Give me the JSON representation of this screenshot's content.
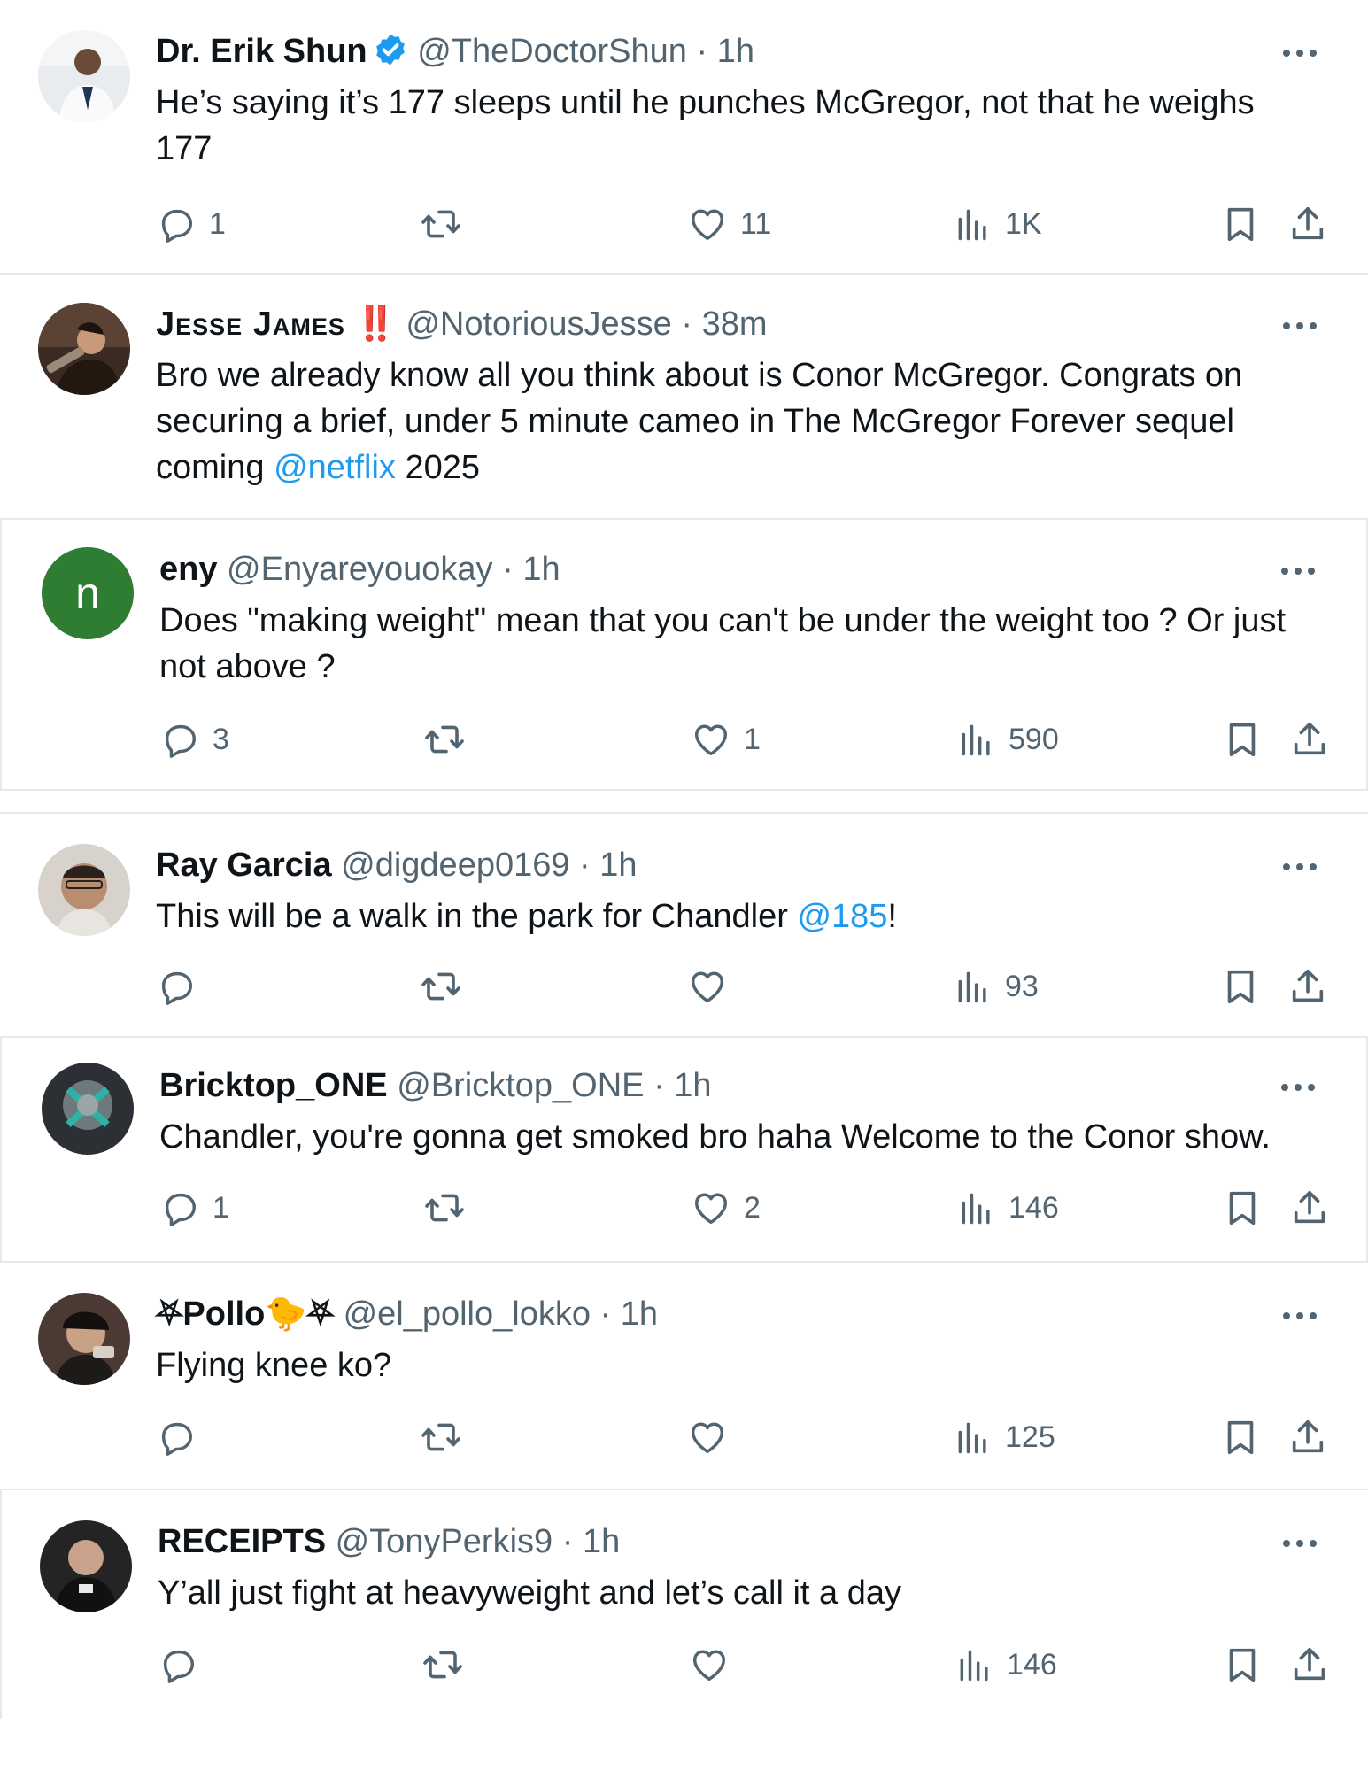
{
  "colors": {
    "accent": "#1d9bf0",
    "text": "#0f1419",
    "muted": "#536471",
    "divider": "#e6e9ec",
    "verified": "#1d9bf0"
  },
  "tweets": [
    {
      "name": "Dr. Erik Shun",
      "verified": true,
      "handle": "@TheDoctorShun",
      "time": "1h",
      "text": "He’s saying it’s 177 sleeps until he punches McGregor, not that he weighs 177",
      "replies": "1",
      "likes": "11",
      "views": "1K"
    },
    {
      "name": "Jesse James",
      "name_emoji": "‼️",
      "handle": "@NotoriousJesse",
      "time": "38m",
      "text_parts": [
        "Bro we already know all you think about is Conor McGregor. Congrats on securing a brief, under 5 minute cameo in The McGregor Forever sequel coming ",
        "@netflix",
        " 2025"
      ]
    },
    {
      "name": "eny",
      "avatar_letter": "n",
      "handle": "@Enyareyouokay",
      "time": "1h",
      "text": "Does \"making weight\" mean that you can't be under the weight too ? Or just not above ?",
      "replies": "3",
      "likes": "1",
      "views": "590"
    },
    {
      "name": "Ray Garcia",
      "handle": "@digdeep0169",
      "time": "1h",
      "text_parts": [
        "This will be a walk in the park for Chandler ",
        "@185",
        "!"
      ],
      "views": "93"
    },
    {
      "name": "Bricktop_ONE",
      "handle": "@Bricktop_ONE",
      "time": "1h",
      "text": "Chandler, you're gonna get smoked bro haha Welcome to the Conor show.",
      "replies": "1",
      "likes": "2",
      "views": "146"
    },
    {
      "name": "⛧Pollo🐤⛧",
      "handle": "@el_pollo_lokko",
      "time": "1h",
      "text": "Flying knee ko?",
      "views": "125"
    },
    {
      "name": "RECEIPTS",
      "handle": "@TonyPerkis9",
      "time": "1h",
      "text": "Y’all just fight at heavyweight and let’s call it a day",
      "views": "146"
    }
  ]
}
